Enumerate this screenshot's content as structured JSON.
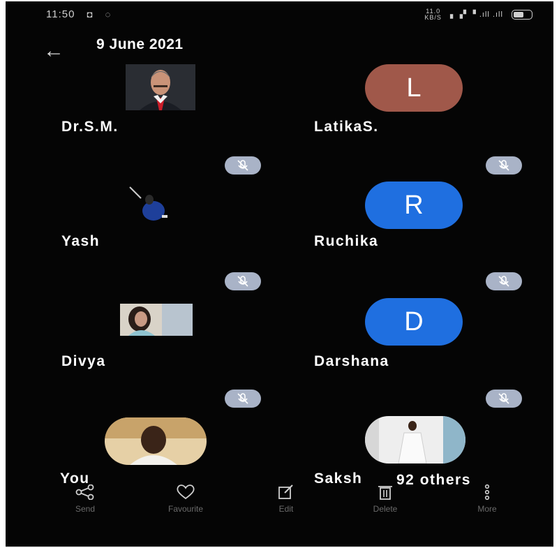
{
  "status_bar": {
    "time": "11:50",
    "net_speed_value": "11.0",
    "net_speed_unit": "KB/S"
  },
  "header": {
    "date": "9 June 2021"
  },
  "participants": [
    {
      "name": "Dr.S.M.",
      "avatar_type": "photo"
    },
    {
      "name": "LatikaS.",
      "avatar_type": "letter",
      "letter": "L",
      "color": "#a0584a"
    },
    {
      "name": "Yash",
      "avatar_type": "photo"
    },
    {
      "name": "Ruchika",
      "avatar_type": "letter",
      "letter": "R",
      "color": "#1f6fe0"
    },
    {
      "name": "Divya",
      "avatar_type": "photo"
    },
    {
      "name": "Darshana",
      "avatar_type": "letter",
      "letter": "D",
      "color": "#1f6fe0"
    },
    {
      "name": "You",
      "avatar_type": "photo"
    },
    {
      "name": "Saksh",
      "avatar_type": "photo"
    }
  ],
  "others_overlay": "92 others",
  "toolbar": {
    "send": "Send",
    "favourite": "Favourite",
    "edit": "Edit",
    "delete": "Delete",
    "more": "More"
  },
  "colors": {
    "background": "#050505",
    "mute_badge": "#a9b3c7",
    "blue_avatar": "#1f6fe0",
    "brown_avatar": "#a0584a"
  }
}
